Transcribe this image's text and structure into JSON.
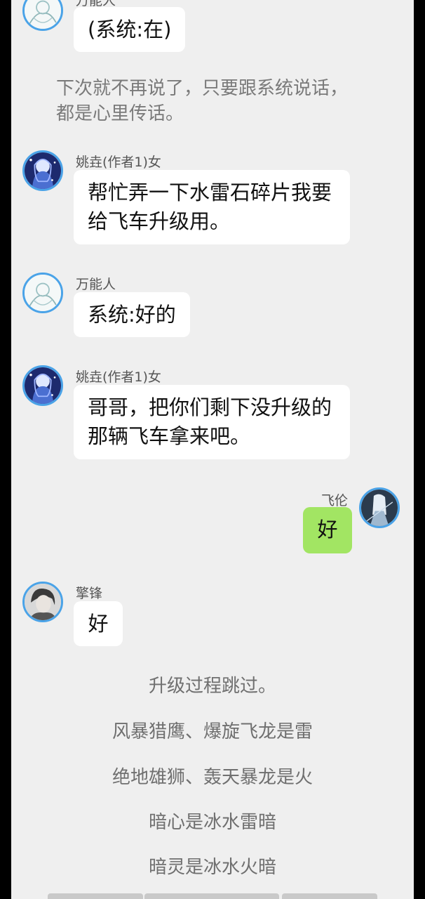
{
  "messages": [
    {
      "sender": "万能人",
      "text": "(系统:在)"
    },
    {
      "sender": "姚垚(作者1)女",
      "text": "帮忙弄一下水雷石碎片我要给飞车升级用。"
    },
    {
      "sender": "万能人",
      "text": "系统:好的"
    },
    {
      "sender": "姚垚(作者1)女",
      "text": "哥哥，把你们剩下没升级的那辆飞车拿来吧。"
    },
    {
      "sender": "飞伦",
      "text": "好"
    },
    {
      "sender": "擎锋",
      "text": "好"
    }
  ],
  "narration": "下次就不再说了，只要跟系统说话，都是心里传话。",
  "center_lines": [
    "升级过程跳过。",
    "风暴猎鹰、爆旋飞龙是雷",
    "绝地雄狮、轰天暴龙是火",
    "暗心是冰水雷暗",
    "暗灵是冰水火暗"
  ],
  "colors": {
    "background": "#efefef",
    "bubble_other": "#ffffff",
    "bubble_self": "#a2e563",
    "avatar_ring": "#4aa3e8"
  },
  "icons": {
    "wanneng": "sketch-figure-avatar",
    "yaoyao": "blue-anime-girl-avatar",
    "feilun": "white-haired-character-avatar",
    "qingfeng": "dark-haired-character-avatar"
  }
}
